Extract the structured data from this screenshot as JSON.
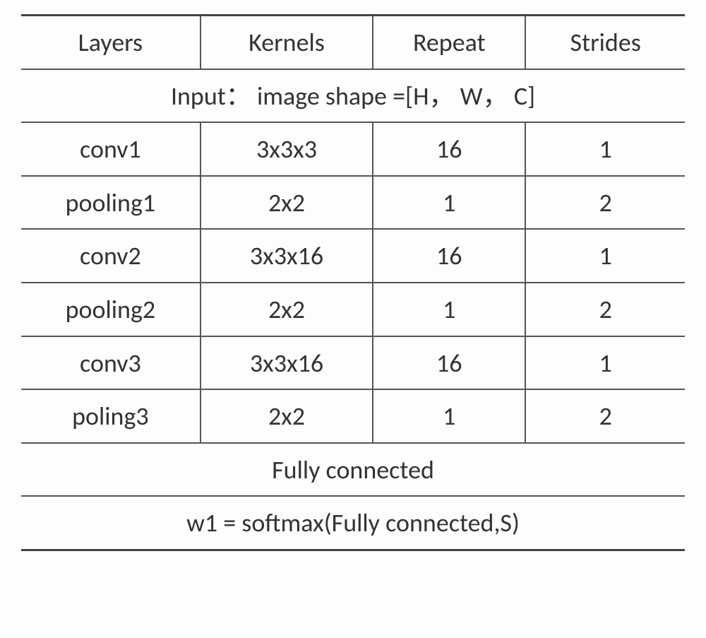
{
  "chart_data": {
    "type": "table",
    "headers": [
      "Layers",
      "Kernels",
      "Repeat",
      "Strides"
    ],
    "input_row": "Input：  image shape =[H，  W，  C]",
    "rows": [
      {
        "layers": "conv1",
        "kernels": "3x3x3",
        "repeat": "16",
        "strides": "1"
      },
      {
        "layers": "pooling1",
        "kernels": "2x2",
        "repeat": "1",
        "strides": "2"
      },
      {
        "layers": "conv2",
        "kernels": "3x3x16",
        "repeat": "16",
        "strides": "1"
      },
      {
        "layers": "pooling2",
        "kernels": "2x2",
        "repeat": "1",
        "strides": "2"
      },
      {
        "layers": "conv3",
        "kernels": "3x3x16",
        "repeat": "16",
        "strides": "1"
      },
      {
        "layers": "poling3",
        "kernels": "2x2",
        "repeat": "1",
        "strides": "2"
      }
    ],
    "footer1": "Fully connected",
    "footer2": "w1 = softmax(Fully connected,S)"
  }
}
